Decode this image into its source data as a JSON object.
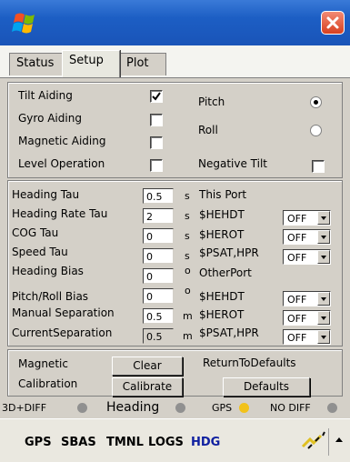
{
  "colors": {
    "title_blue": "#1c5ec4",
    "gray_dot": "#909090",
    "yellow_dot": "#f2c21a",
    "hdg_blue": "#1020a0"
  },
  "titlebar": {
    "logo_icon": "windows-flag-icon",
    "close_icon": "close-icon"
  },
  "tabs": [
    {
      "label": "Status"
    },
    {
      "label": "Setup"
    },
    {
      "label": "Plot"
    }
  ],
  "aiding": {
    "tilt_aiding": "Tilt Aiding",
    "gyro_aiding": "Gyro Aiding",
    "magnetic_aiding": "Magnetic Aiding",
    "level_operation": "Level Operation",
    "tilt_checked": true,
    "pitch": "Pitch",
    "roll": "Roll",
    "negative_tilt": "Negative Tilt",
    "selected_axis": "Pitch"
  },
  "params": [
    {
      "label": "Heading Tau",
      "value": "0.5",
      "unit": "s"
    },
    {
      "label": "Heading Rate Tau",
      "value": "2",
      "unit": "s"
    },
    {
      "label": "COG Tau",
      "value": "0",
      "unit": "s"
    },
    {
      "label": "Speed Tau",
      "value": "0",
      "unit": "s"
    },
    {
      "label": "Heading Bias",
      "value": "0",
      "unit": "o"
    },
    {
      "label": "Pitch/Roll Bias",
      "value": "0",
      "unit": "o"
    },
    {
      "label": "Manual Separation",
      "value": "0.5",
      "unit": "m"
    },
    {
      "label": "CurrentSeparation",
      "value": "0.5",
      "unit": "m"
    }
  ],
  "ports": {
    "this_port": "This Port",
    "other_port": "OtherPort",
    "this_msgs": [
      {
        "msg": "$HEHDT",
        "value": "OFF"
      },
      {
        "msg": "$HEROT",
        "value": "OFF"
      },
      {
        "msg": "$PSAT,HPR",
        "value": "OFF"
      }
    ],
    "other_msgs": [
      {
        "msg": "$HEHDT",
        "value": "OFF"
      },
      {
        "msg": "$HEROT",
        "value": "OFF"
      },
      {
        "msg": "$PSAT,HPR",
        "value": "OFF"
      }
    ]
  },
  "calibration": {
    "magnetic": "Magnetic",
    "calibration": "Calibration",
    "clear": "Clear",
    "calibrate": "Calibrate",
    "return_to_defaults": "ReturnToDefaults",
    "defaults": "Defaults"
  },
  "status": {
    "diff": "3D+DIFF",
    "heading": "Heading",
    "gps": "GPS",
    "no_diff": "NO DIFF"
  },
  "menu": [
    "GPS",
    "SBAS",
    "TMNL",
    "LOGS",
    "HDG"
  ]
}
